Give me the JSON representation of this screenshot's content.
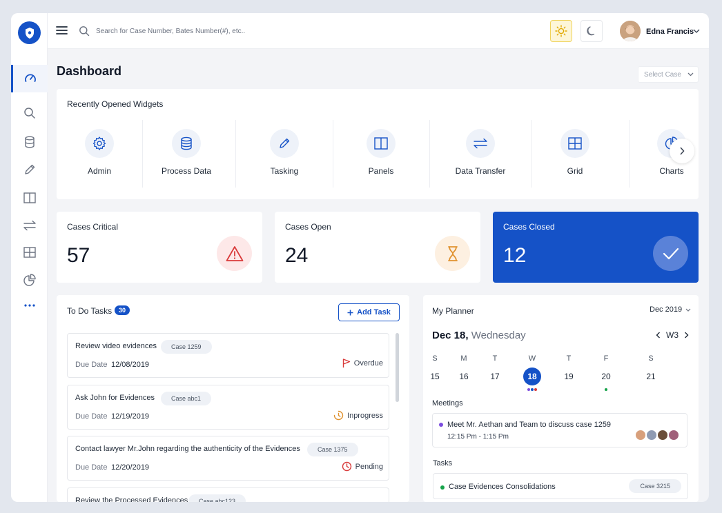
{
  "search": {
    "placeholder": "Search for Case Number, Bates Number(#), etc.."
  },
  "user": {
    "name": "Edna Francis"
  },
  "page": {
    "title": "Dashboard",
    "select_case": "Select Case"
  },
  "widgets": {
    "title": "Recently Opened Widgets",
    "items": [
      {
        "label": "Admin",
        "icon": "gear-icon"
      },
      {
        "label": "Process Data",
        "icon": "database-icon"
      },
      {
        "label": "Tasking",
        "icon": "pencil-icon"
      },
      {
        "label": "Panels",
        "icon": "panels-icon"
      },
      {
        "label": "Data Transfer",
        "icon": "transfer-icon"
      },
      {
        "label": "Grid",
        "icon": "grid-icon"
      },
      {
        "label": "Charts",
        "icon": "pie-chart-icon"
      }
    ]
  },
  "stats": {
    "critical": {
      "label": "Cases Critical",
      "value": "57"
    },
    "open": {
      "label": "Cases Open",
      "value": "24"
    },
    "closed": {
      "label": "Cases Closed",
      "value": "12"
    }
  },
  "todo": {
    "title": "To Do Tasks",
    "count": "30",
    "add_label": "Add Task",
    "due_label": "Due Date",
    "tasks": [
      {
        "title": "Review video evidences",
        "badge": "Case 1259",
        "date": "12/08/2019",
        "status": "Overdue"
      },
      {
        "title": "Ask John for Evidences",
        "badge": "Case abc1",
        "date": "12/19/2019",
        "status": "Inprogress"
      },
      {
        "title": "Contact lawyer Mr.John regarding the authenticity of the Evidences",
        "badge": "Case 1375",
        "date": "12/20/2019",
        "status": "Pending"
      },
      {
        "title": "Review the Processed Evidences",
        "badge": "Case abc123",
        "date": "",
        "status": ""
      }
    ]
  },
  "planner": {
    "title": "My Planner",
    "month": "Dec 2019",
    "date_main": "Dec 18,",
    "date_day": "Wednesday",
    "week": "W3",
    "days": [
      {
        "name": "S",
        "num": "15"
      },
      {
        "name": "M",
        "num": "16"
      },
      {
        "name": "T",
        "num": "17"
      },
      {
        "name": "W",
        "num": "18"
      },
      {
        "name": "T",
        "num": "19"
      },
      {
        "name": "F",
        "num": "20"
      },
      {
        "name": "S",
        "num": "21"
      }
    ],
    "meetings_title": "Meetings",
    "meeting": {
      "title": "Meet Mr. Aethan and Team to discuss case 1259",
      "time": "12:15 Pm - 1:15 Pm"
    },
    "tasks_title": "Tasks",
    "task": {
      "title": "Case Evidences Consolidations",
      "badge": "Case 3215"
    }
  },
  "colors": {
    "primary": "#1552c7",
    "critical": "#d93a3a",
    "open": "#e0922f",
    "overdue": "#d93a3a",
    "inprogress": "#e0922f",
    "pending": "#d93a3a"
  }
}
